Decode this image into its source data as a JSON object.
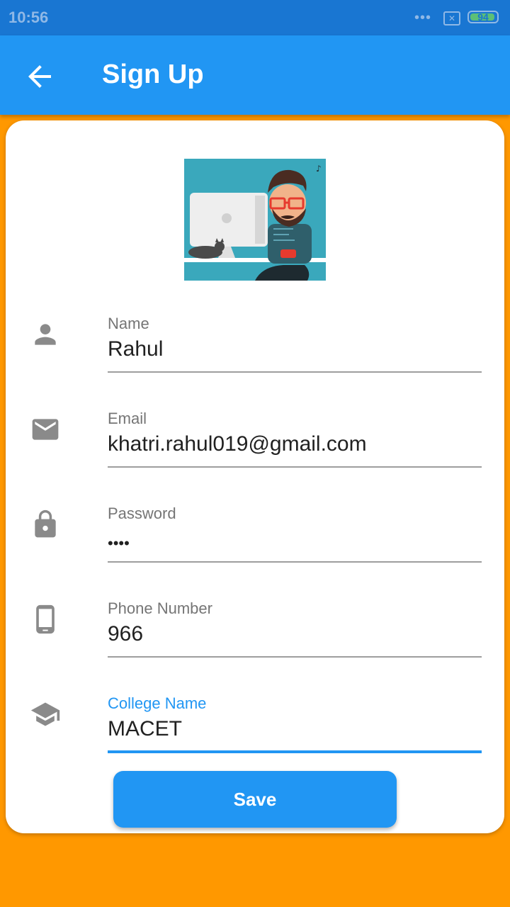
{
  "status_bar": {
    "time": "10:56",
    "signal_dots": "•••",
    "notification_icon": "close-box-icon",
    "battery": "94",
    "battery_level": 0.94
  },
  "app_bar": {
    "title": "Sign Up",
    "back_icon": "arrow-back-icon"
  },
  "form": {
    "fields": [
      {
        "label": "Name",
        "value": "Rahul",
        "icon": "person-icon"
      },
      {
        "label": "Email",
        "value": "khatri.rahul019@gmail.com",
        "icon": "email-icon"
      },
      {
        "label": "Password",
        "value": "••••",
        "icon": "lock-icon"
      },
      {
        "label": "Phone Number",
        "value": "966",
        "icon": "phone-icon"
      },
      {
        "label": "College Name",
        "value": "MACET",
        "icon": "school-icon"
      }
    ],
    "save_label": "Save"
  },
  "colors": {
    "primary": "#2196F3",
    "status_bar": "#1976D2",
    "background": "#FF9800",
    "card": "#FFFFFF"
  }
}
